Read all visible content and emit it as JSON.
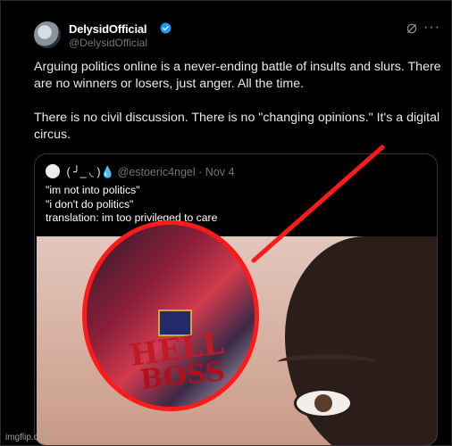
{
  "user": {
    "name": "DelysidOfficial",
    "handle": "@DelysidOfficial"
  },
  "tweet": {
    "paragraphs": [
      "Arguing politics online is a never-ending battle of insults and slurs. There are no winners or losers, just anger. All the time.",
      "There is no civil discussion. There is no \"changing opinions.\" It's a digital circus."
    ]
  },
  "quote": {
    "name": "( ╯_ ◟ )💧",
    "handle": "@estoeric4ngel",
    "separator": "·",
    "date": "Nov 4",
    "lines": [
      "\"im not into politics\"",
      "\"i don't do politics\"",
      "translation: im too privileged to care"
    ]
  },
  "image_text": {
    "line1": "HELL",
    "line2": "BOSS"
  },
  "watermark": "imgflip.com",
  "icons": {
    "verified": "verified-badge-icon",
    "grok": "grok-icon",
    "more": "more-icon"
  },
  "colors": {
    "background": "#000000",
    "accent": "#1d9bf0",
    "annotation": "#ff1a1a"
  }
}
